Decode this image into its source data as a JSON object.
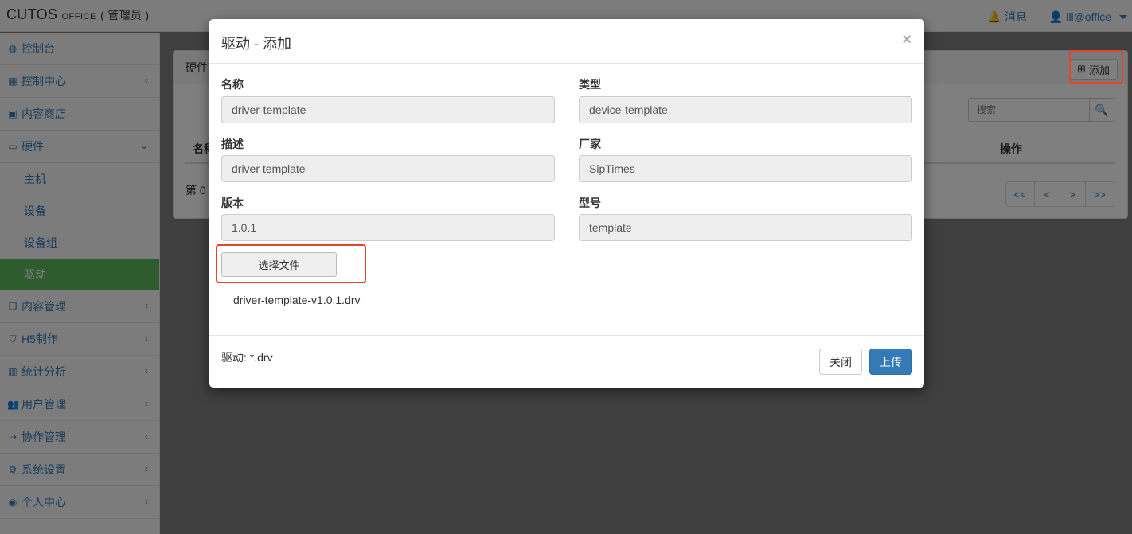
{
  "app": {
    "brand": "CUTOS",
    "brand_sub": "OFFICE",
    "role": "( 管理员 )",
    "notifications_label": "消息",
    "user_label": "lll@office"
  },
  "sidebar": {
    "items": [
      {
        "label": "控制台",
        "icon": "dashboard-icon"
      },
      {
        "label": "控制中心",
        "icon": "grid-icon"
      },
      {
        "label": "内容商店",
        "icon": "shopping-bag-icon"
      },
      {
        "label": "硬件",
        "icon": "desktop-icon"
      },
      {
        "label": "内容管理",
        "icon": "copy-icon"
      },
      {
        "label": "H5制作",
        "icon": "html5-icon"
      },
      {
        "label": "统计分析",
        "icon": "bar-chart-icon"
      },
      {
        "label": "用户管理",
        "icon": "users-icon"
      },
      {
        "label": "协作管理",
        "icon": "collaboration-icon"
      },
      {
        "label": "系统设置",
        "icon": "gear-icon"
      },
      {
        "label": "个人中心",
        "icon": "user-circle-icon"
      }
    ],
    "hardware_sub": [
      "主机",
      "设备",
      "设备组",
      "驱动"
    ],
    "active_sub": "驱动"
  },
  "panel": {
    "title": "硬件",
    "add_label": "添加",
    "search_placeholder": "搜索",
    "col_name": "名称",
    "col_action": "操作",
    "page_info": "第 0",
    "pager": [
      "<<",
      "<",
      ">",
      ">>"
    ]
  },
  "modal": {
    "title": "驱动 - 添加",
    "close_symbol": "×",
    "fields": {
      "name_label": "名称",
      "name_value": "driver-template",
      "type_label": "类型",
      "type_value": "device-template",
      "desc_label": "描述",
      "desc_value": "driver template",
      "vendor_label": "厂家",
      "vendor_value": "SipTimes",
      "version_label": "版本",
      "version_value": "1.0.1",
      "model_label": "型号",
      "model_value": "template"
    },
    "file_button": "选择文件",
    "file_name": "driver-template-v1.0.1.drv",
    "footer_note": "驱动: *.drv",
    "close_button": "关闭",
    "upload_button": "上传"
  },
  "colors": {
    "primary": "#337ab7",
    "active_green": "#5cb85c",
    "highlight_red": "#e8422a"
  }
}
